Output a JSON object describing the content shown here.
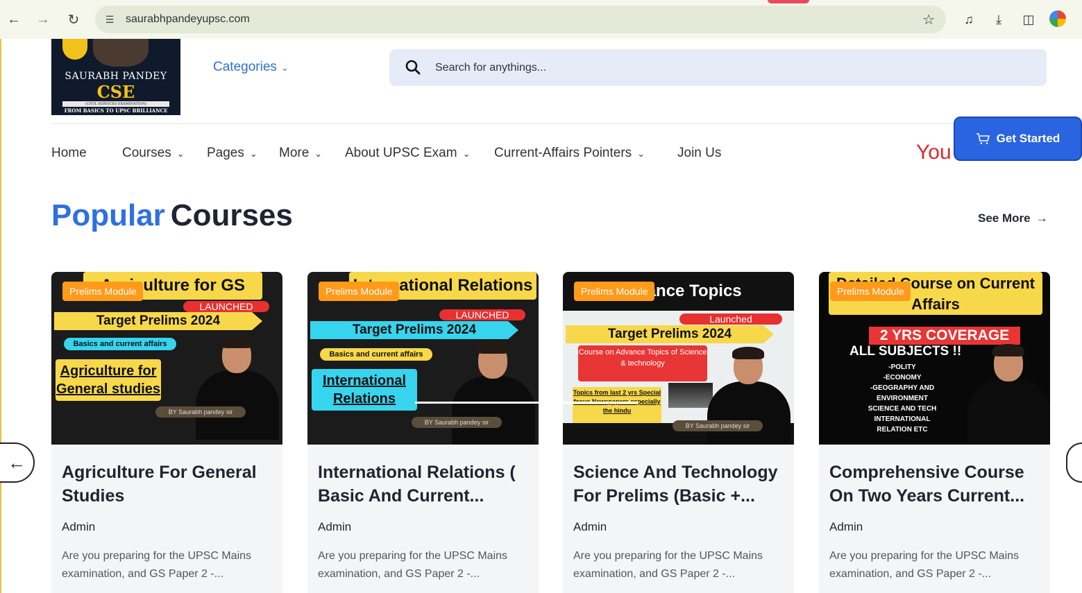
{
  "browser": {
    "url": "saurabhpandeyupsc.com",
    "icons": [
      "back-arrow-icon",
      "forward-arrow-icon",
      "reload-icon",
      "site-info-icon",
      "star-icon",
      "media-queue-icon",
      "download-icon",
      "side-panel-icon",
      "profile-avatar"
    ]
  },
  "logo": {
    "line1": "SAURABH PANDEY",
    "line2": "CSE",
    "line3": "(CIVIL SERVICES EXAMINATION)",
    "line4": "FROM BASICS TO UPSC BRILLIANCE"
  },
  "header": {
    "categories_label": "Categories",
    "search_placeholder": "Search for anythings..."
  },
  "nav": {
    "items": [
      {
        "label": "Home"
      },
      {
        "label": "Courses"
      },
      {
        "label": "Pages"
      },
      {
        "label": "More"
      },
      {
        "label": "About UPSC Exam"
      },
      {
        "label": "Current-Affairs Pointers"
      },
      {
        "label": "Join Us"
      }
    ],
    "you_text": "You",
    "get_started_label": "Get Started"
  },
  "section": {
    "title_highlight": "Popular",
    "title_rest": "Courses",
    "see_more_label": "See More"
  },
  "cards": [
    {
      "module_badge": "Prelims Module",
      "thumb_banner": "Agriculture for GS",
      "thumb_launched": "LAUNCHED",
      "thumb_target": "Target Prelims 2024",
      "thumb_basics": "Basics and current affairs",
      "thumb_subject": "Agriculture for General studies",
      "thumb_sig": "BY Saurabh pandey sir",
      "title": "Agriculture For General Studies",
      "author": "Admin",
      "description": "Are you preparing for the UPSC Mains examination, and GS Paper 2 -..."
    },
    {
      "module_badge": "Prelims Module",
      "thumb_banner": "International Relations",
      "thumb_launched": "LAUNCHED",
      "thumb_target": "Target Prelims 2024",
      "thumb_basics": "Basics and current affairs",
      "thumb_subject": "International Relations",
      "thumb_sig": "BY Saurabh pandey sir",
      "title": "International Relations ( Basic And Current...",
      "author": "Admin",
      "description": "Are you preparing for the UPSC Mains examination, and GS Paper 2 -..."
    },
    {
      "module_badge": "Prelims Module",
      "thumb_banner": "Advance Topics",
      "thumb_launched": "Launched",
      "thumb_target": "Target Prelims  2024",
      "thumb_mid": "Course on Advance Topics of Science & technology",
      "thumb_topics": "Topics from last 2 yrs Special focus Newspapers especially the hindu",
      "thumb_sig": "BY Saurabh pandey sir",
      "title": "Science And Technology For Prelims (Basic +...",
      "author": "Admin",
      "description": "Are you preparing for the UPSC Mains examination, and GS Paper 2 -..."
    },
    {
      "module_badge": "Prelims Module",
      "thumb_banner": "Detailed Course on Current Affairs",
      "thumb_coverage": "2 YRS COVERAGE",
      "thumb_allsub": "ALL SUBJECTS !!",
      "thumb_list": [
        "-POLITY",
        "-ECONOMY",
        "-GEOGRAPHY AND",
        "ENVIRONMENT",
        "SCIENCE AND TECH",
        "INTERNATIONAL",
        "RELATION ETC"
      ],
      "title": "Comprehensive Course On Two Years Current...",
      "author": "Admin",
      "description": "Are you preparing for the UPSC Mains examination, and GS Paper 2 -..."
    }
  ],
  "colors": {
    "accent_blue": "#2f6fe0",
    "button_blue": "#2a64e0",
    "badge_orange": "#ff9a1a",
    "thumb_yellow": "#f7d84a",
    "red": "#e83535"
  }
}
